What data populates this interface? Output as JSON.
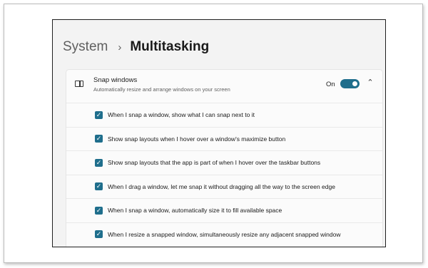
{
  "breadcrumb": {
    "parent": "System",
    "separator": "›",
    "current": "Multitasking"
  },
  "snap_windows": {
    "title": "Snap windows",
    "subtitle": "Automatically resize and arrange windows on your screen",
    "toggle_label": "On",
    "toggle_on": true,
    "expanded": true
  },
  "options": [
    {
      "label": "When I snap a window, show what I can snap next to it",
      "checked": true
    },
    {
      "label": "Show snap layouts when I hover over a window's maximize button",
      "checked": true
    },
    {
      "label": "Show snap layouts that the app is part of when I hover over the taskbar buttons",
      "checked": true
    },
    {
      "label": "When I drag a window, let me snap it without dragging all the way to the screen edge",
      "checked": true
    },
    {
      "label": "When I snap a window, automatically size it to fill available space",
      "checked": true
    },
    {
      "label": "When I resize a snapped window, simultaneously resize any adjacent snapped window",
      "checked": true
    }
  ],
  "colors": {
    "accent": "#1f6e8c",
    "window_bg": "#f3f3f3",
    "panel_bg": "#fbfbfb"
  },
  "icons": {
    "snap": "snap-windows-icon",
    "check": "✓",
    "collapse": "⌃"
  }
}
